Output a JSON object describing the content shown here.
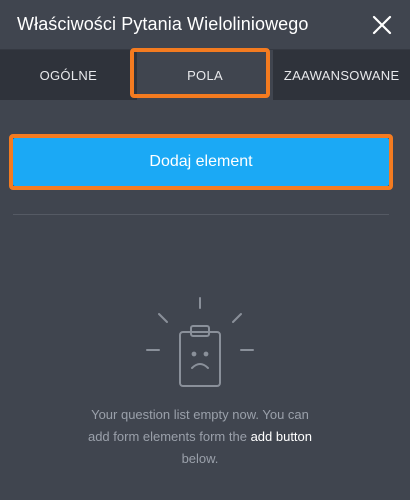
{
  "header": {
    "title": "Właściwości Pytania Wieloliniowego",
    "close_icon": "close-icon"
  },
  "tabs": [
    {
      "label": "OGÓLNE",
      "active": false
    },
    {
      "label": "POLA",
      "active": true
    },
    {
      "label": "ZAAWANSOWANE",
      "active": false
    }
  ],
  "main": {
    "add_button_label": "Dodaj element",
    "empty_icon": "clipboard-sad-icon",
    "empty_text_before": "Your question list empty now. You can add form elements form the",
    "empty_text_strong": "add button",
    "empty_text_after": "below."
  },
  "colors": {
    "panel_bg": "#40454f",
    "tabs_bg": "#2f333b",
    "accent": "#1ba9f5",
    "highlight": "#f47b20"
  }
}
